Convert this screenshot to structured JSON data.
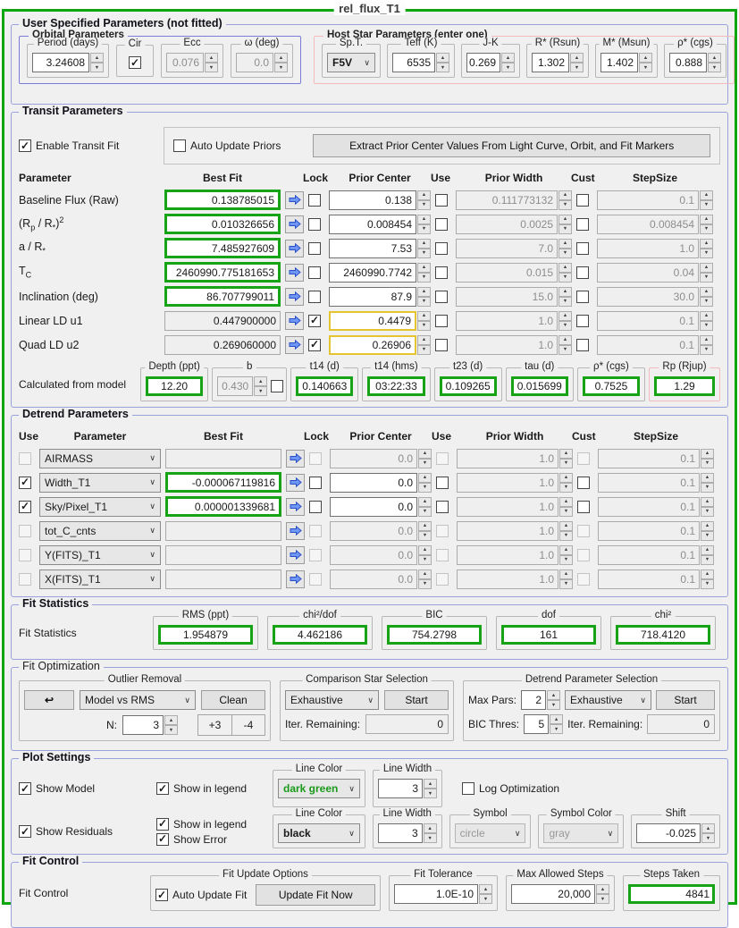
{
  "colors": {
    "frame_green": "#0ea60e",
    "value_green": "#16a316",
    "prior_gold": "#e6c331",
    "section_blue": "#99a2dd",
    "orbital_blue": "#7b7bd8",
    "host_pink": "#f2baba",
    "bg": "#f0f0f0",
    "arrow_blue": "#6f96f5",
    "dark_green_text": "#1a9a1a"
  },
  "window": {
    "title": "rel_flux_T1"
  },
  "user_params": {
    "title": "User Specified Parameters (not fitted)",
    "orbital": {
      "title": "Orbital Parameters",
      "period_label": "Period (days)",
      "period": "3.24608",
      "cir_label": "Cir",
      "cir_checked": true,
      "ecc_label": "Ecc",
      "ecc": "0.076",
      "omega_label": "ω (deg)",
      "omega": "0.0"
    },
    "host": {
      "title": "Host Star Parameters (enter one)",
      "spt_label": "Sp.T.",
      "spt": "F5V",
      "teff_label": "Teff (K)",
      "teff": "6535",
      "jk_label": "J-K",
      "jk": "0.269",
      "rstar_label": "R* (Rsun)",
      "rstar": "1.302",
      "mstar_label": "M* (Msun)",
      "mstar": "1.402",
      "rho_label": "ρ* (cgs)",
      "rho": "0.888"
    }
  },
  "transit": {
    "title": "Transit Parameters",
    "enable_label": "Enable Transit Fit",
    "enable_checked": true,
    "auto_label": "Auto Update Priors",
    "auto_checked": false,
    "extract_button": "Extract Prior Center Values From Light Curve, Orbit, and Fit Markers",
    "headers": {
      "param": "Parameter",
      "best": "Best Fit",
      "lock": "Lock",
      "prior": "Prior Center",
      "use": "Use",
      "width": "Prior Width",
      "cust": "Cust",
      "step": "StepSize"
    },
    "rows": [
      {
        "label_rich": [
          [
            "Baseline Flux (Raw)",
            ""
          ]
        ],
        "best_fit": "0.138785015",
        "locked": false,
        "locked_style": false,
        "prior_center": "0.138",
        "prior_highlight": false,
        "use_prior": false,
        "prior_width": "0.111773132",
        "cust": false,
        "step": "0.1"
      },
      {
        "label_rich": [
          [
            "(R",
            ""
          ],
          [
            "p",
            "sub"
          ],
          [
            " / R",
            ""
          ],
          [
            "*",
            "sub"
          ],
          [
            ")",
            ""
          ],
          [
            "2",
            "sup"
          ]
        ],
        "best_fit": "0.010326656",
        "locked": false,
        "locked_style": false,
        "prior_center": "0.008454",
        "prior_highlight": false,
        "use_prior": false,
        "prior_width": "0.0025",
        "cust": false,
        "step": "0.008454"
      },
      {
        "label_rich": [
          [
            "a / R",
            ""
          ],
          [
            "*",
            "sub"
          ]
        ],
        "best_fit": "7.485927609",
        "locked": false,
        "locked_style": false,
        "prior_center": "7.53",
        "prior_highlight": false,
        "use_prior": false,
        "prior_width": "7.0",
        "cust": false,
        "step": "1.0"
      },
      {
        "label_rich": [
          [
            "T",
            ""
          ],
          [
            "C",
            "sub"
          ]
        ],
        "best_fit": "2460990.775181653",
        "locked": false,
        "locked_style": false,
        "prior_center": "2460990.7742",
        "prior_highlight": false,
        "use_prior": false,
        "prior_width": "0.015",
        "cust": false,
        "step": "0.04"
      },
      {
        "label_rich": [
          [
            "Inclination (deg)",
            ""
          ]
        ],
        "best_fit": "86.707799011",
        "locked": false,
        "locked_style": false,
        "prior_center": "87.9",
        "prior_highlight": false,
        "use_prior": false,
        "prior_width": "15.0",
        "cust": false,
        "step": "30.0"
      },
      {
        "label_rich": [
          [
            "Linear LD u1",
            ""
          ]
        ],
        "best_fit": "0.447900000",
        "locked": true,
        "locked_style": true,
        "prior_center": "0.4479",
        "prior_highlight": true,
        "use_prior": false,
        "prior_width": "1.0",
        "cust": false,
        "step": "0.1"
      },
      {
        "label_rich": [
          [
            "Quad LD u2",
            ""
          ]
        ],
        "best_fit": "0.269060000",
        "locked": true,
        "locked_style": true,
        "prior_center": "0.26906",
        "prior_highlight": true,
        "use_prior": false,
        "prior_width": "1.0",
        "cust": false,
        "step": "0.1"
      }
    ],
    "calculated": {
      "label": "Calculated from model",
      "depth_title": "Depth (ppt)",
      "depth": "12.20",
      "b_title": "b",
      "b": "0.430",
      "b_checked": false,
      "t14d_title": "t14 (d)",
      "t14d": "0.140663",
      "t14h_title": "t14 (hms)",
      "t14h": "03:22:33",
      "t23_title": "t23 (d)",
      "t23": "0.109265",
      "tau_title": "tau (d)",
      "tau": "0.015699",
      "rho_title": "ρ* (cgs)",
      "rho": "0.7525",
      "rp_title": "Rp (Rjup)",
      "rp": "1.29"
    }
  },
  "detrend": {
    "title": "Detrend Parameters",
    "headers": {
      "use": "Use",
      "param": "Parameter",
      "best": "Best Fit",
      "lock": "Lock",
      "prior": "Prior Center",
      "use2": "Use",
      "width": "Prior Width",
      "cust": "Cust",
      "step": "StepSize"
    },
    "rows": [
      {
        "use": false,
        "active": false,
        "param": "AIRMASS",
        "best_fit": "",
        "locked": false,
        "prior_center": "0.0",
        "use_prior": false,
        "prior_width": "1.0",
        "cust": false,
        "step": "0.1"
      },
      {
        "use": true,
        "active": true,
        "param": "Width_T1",
        "best_fit": "-0.000067119816",
        "locked": false,
        "prior_center": "0.0",
        "use_prior": false,
        "prior_width": "1.0",
        "cust": false,
        "step": "0.1"
      },
      {
        "use": true,
        "active": true,
        "param": "Sky/Pixel_T1",
        "best_fit": "0.000001339681",
        "locked": false,
        "prior_center": "0.0",
        "use_prior": false,
        "prior_width": "1.0",
        "cust": false,
        "step": "0.1"
      },
      {
        "use": false,
        "active": false,
        "param": "tot_C_cnts",
        "best_fit": "",
        "locked": false,
        "prior_center": "0.0",
        "use_prior": false,
        "prior_width": "1.0",
        "cust": false,
        "step": "0.1"
      },
      {
        "use": false,
        "active": false,
        "param": "Y(FITS)_T1",
        "best_fit": "",
        "locked": false,
        "prior_center": "0.0",
        "use_prior": false,
        "prior_width": "1.0",
        "cust": false,
        "step": "0.1"
      },
      {
        "use": false,
        "active": false,
        "param": "X(FITS)_T1",
        "best_fit": "",
        "locked": false,
        "prior_center": "0.0",
        "use_prior": false,
        "prior_width": "1.0",
        "cust": false,
        "step": "0.1"
      }
    ]
  },
  "fit_stats": {
    "title": "Fit Statistics",
    "label": "Fit Statistics",
    "fields": [
      {
        "title": "RMS (ppt)",
        "value": "1.954879"
      },
      {
        "title": "chi²/dof",
        "value": "4.462186"
      },
      {
        "title": "BIC",
        "value": "754.2798"
      },
      {
        "title": "dof",
        "value": "161"
      },
      {
        "title": "chi²",
        "value": "718.4120"
      }
    ]
  },
  "fit_opt": {
    "title": "Fit Optimization",
    "outlier": {
      "title": "Outlier Removal",
      "undo_glyph": "↩",
      "mode": "Model vs RMS",
      "clean": "Clean",
      "n_label": "N:",
      "n": "3",
      "added": "+3",
      "removed": "-4"
    },
    "comp": {
      "title": "Comparison Star Selection",
      "mode": "Exhaustive",
      "start": "Start",
      "iter_label": "Iter. Remaining:",
      "iter": "0"
    },
    "dsel": {
      "title": "Detrend Parameter Selection",
      "max_label": "Max Pars:",
      "max": "2",
      "mode": "Exhaustive",
      "start": "Start",
      "bic_label": "BIC Thres:",
      "bic": "5",
      "iter_label": "Iter. Remaining:",
      "iter": "0"
    }
  },
  "plot": {
    "title": "Plot Settings",
    "show_model": "Show Model",
    "show_model_checked": true,
    "model_legend": "Show in legend",
    "model_legend_checked": true,
    "model_color_title": "Line Color",
    "model_color": "dark green",
    "model_width_title": "Line Width",
    "model_width": "3",
    "log_label": "Log Optimization",
    "log_checked": false,
    "show_res": "Show Residuals",
    "show_res_checked": true,
    "res_legend": "Show in legend",
    "res_legend_checked": true,
    "res_error": "Show Error",
    "res_error_checked": true,
    "res_color_title": "Line Color",
    "res_color": "black",
    "res_width_title": "Line Width",
    "res_width": "3",
    "symbol_title": "Symbol",
    "symbol": "circle",
    "symcolor_title": "Symbol Color",
    "symcolor": "gray",
    "shift_title": "Shift",
    "shift": "-0.025"
  },
  "fit_control": {
    "title": "Fit Control",
    "label": "Fit Control",
    "update_title": "Fit Update Options",
    "auto_label": "Auto Update Fit",
    "auto_checked": true,
    "update_btn": "Update Fit Now",
    "tol_title": "Fit Tolerance",
    "tol": "1.0E-10",
    "max_title": "Max Allowed Steps",
    "max": "20,000",
    "steps_title": "Steps Taken",
    "steps": "4841"
  }
}
